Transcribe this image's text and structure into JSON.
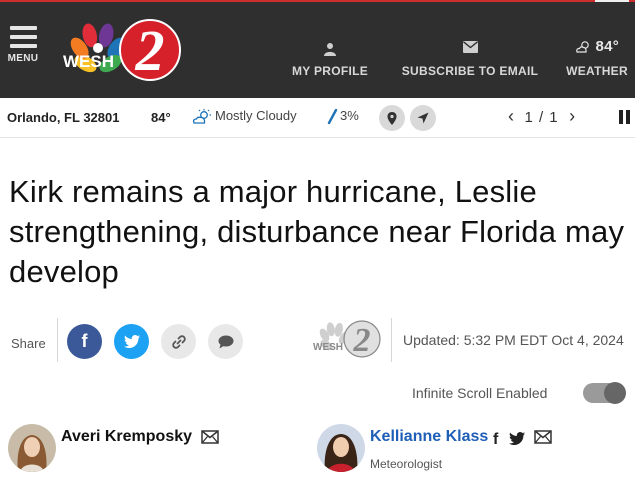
{
  "header": {
    "menu_label": "MENU",
    "logo_text": "WESH",
    "logo_number": "2",
    "profile_label": "MY PROFILE",
    "subscribe_label": "SUBSCRIBE TO EMAIL",
    "weather_label": "WEATHER",
    "weather_temp": "84°",
    "icons": {
      "menu": "hamburger-icon",
      "profile": "person-icon",
      "subscribe": "envelope-icon",
      "weather": "partly-cloudy-icon"
    }
  },
  "weather_bar": {
    "location": "Orlando, FL 32801",
    "temperature": "84°",
    "condition": "Mostly Cloudy",
    "precip": "3%",
    "pager": "1 / 1",
    "icons": {
      "condition": "cloud-sun-icon",
      "precip": "raindrop-icon",
      "pin": "map-pin-icon",
      "locate": "location-arrow-icon",
      "prev": "chevron-left-icon",
      "next": "chevron-right-icon",
      "pause": "pause-icon"
    }
  },
  "article": {
    "headline": "Kirk remains a major hurricane, Leslie strengthening, disturbance near Florida may develop",
    "share_label": "Share",
    "updated": "Updated: 5:32 PM EDT Oct 4, 2024",
    "infinite_scroll_label": "Infinite Scroll Enabled",
    "infinite_scroll_on": true
  },
  "authors": [
    {
      "name": "Averi Kremposky",
      "role": ""
    },
    {
      "name": "Kellianne Klass",
      "role": "Meteorologist"
    }
  ],
  "colors": {
    "header_bg": "#2f2f2f",
    "accent_red": "#cf2e2e",
    "facebook": "#3b5998",
    "twitter": "#1da1f2",
    "author_link": "#1f5fb7"
  }
}
